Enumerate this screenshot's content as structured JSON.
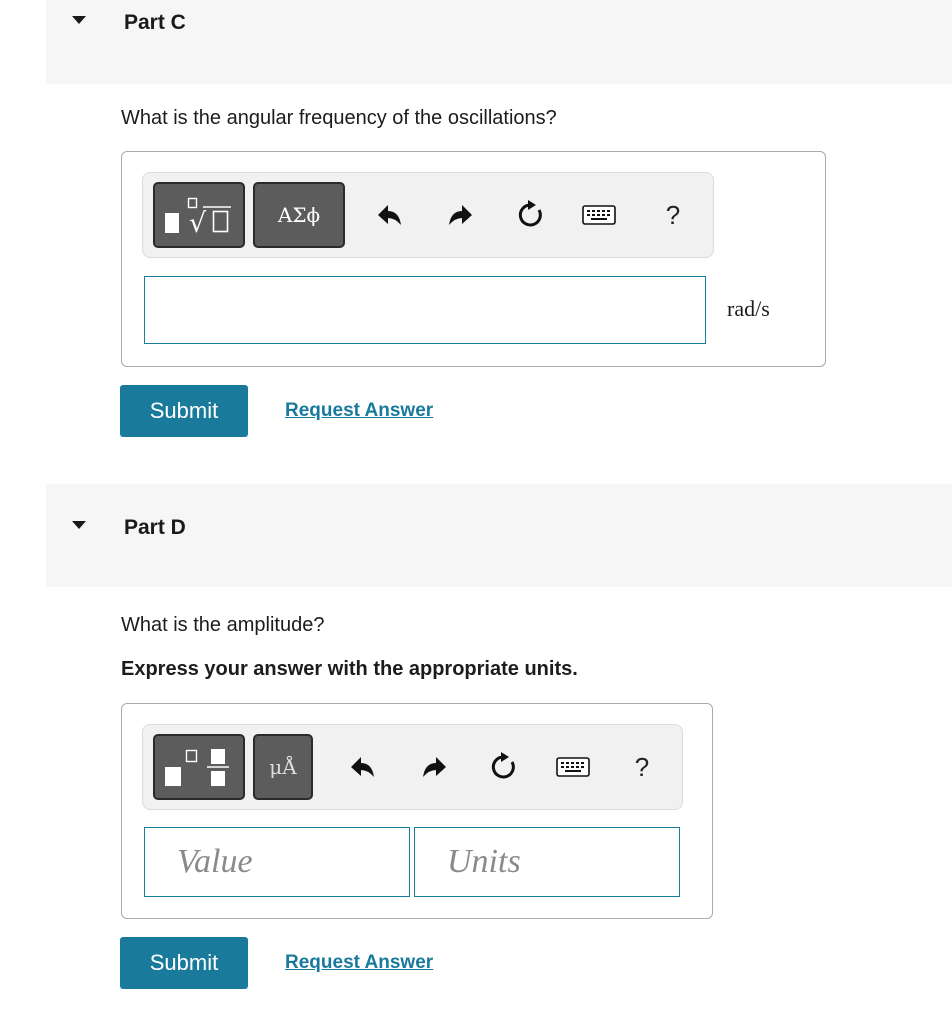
{
  "part_c": {
    "title": "Part C",
    "question": "What is the angular frequency of the oscillations?",
    "toolbar": {
      "template_icon": "fraction-root-template-icon",
      "greek_label": "ΑΣϕ",
      "undo_icon": "undo-icon",
      "redo_icon": "redo-icon",
      "reset_icon": "reset-icon",
      "keyboard_icon": "keyboard-icon",
      "help_label": "?"
    },
    "input_value": "",
    "unit": "rad/s",
    "submit_label": "Submit",
    "request_label": "Request Answer"
  },
  "part_d": {
    "title": "Part D",
    "question": "What is the amplitude?",
    "instruction": "Express your answer with the appropriate units.",
    "toolbar": {
      "template_icon": "superscript-fraction-template-icon",
      "units_label": "μÅ",
      "undo_icon": "undo-icon",
      "redo_icon": "redo-icon",
      "reset_icon": "reset-icon",
      "keyboard_icon": "keyboard-icon",
      "help_label": "?"
    },
    "value_placeholder": "Value",
    "units_placeholder": "Units",
    "submit_label": "Submit",
    "request_label": "Request Answer"
  },
  "colors": {
    "accent": "#1a7a9c",
    "header_bg": "#f6f6f6",
    "tool_button": "#5c5c5c"
  }
}
